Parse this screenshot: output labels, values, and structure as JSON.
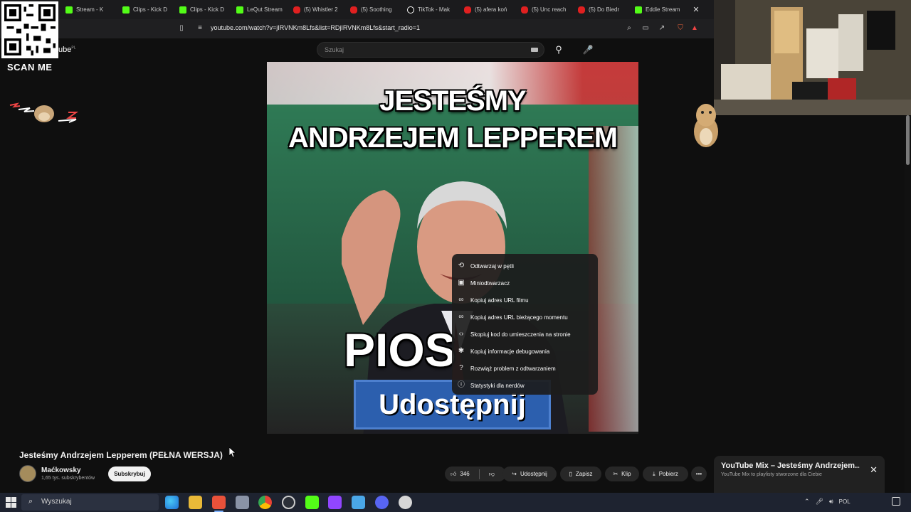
{
  "browser": {
    "tabs": [
      {
        "label": "Stream - K",
        "type": "kick"
      },
      {
        "label": "Clips - Kick D",
        "type": "kick"
      },
      {
        "label": "Clips - Kick D",
        "type": "kick"
      },
      {
        "label": "LeQut Stream",
        "type": "kick"
      },
      {
        "label": "(5) Whistler 2",
        "type": "yt"
      },
      {
        "label": "(5) Soothing",
        "type": "yt"
      },
      {
        "label": "TikTok - Mak",
        "type": "tt"
      },
      {
        "label": "(5) afera koń",
        "type": "yt"
      },
      {
        "label": "(5) Unc reach",
        "type": "yt"
      },
      {
        "label": "(5) Do Biedr",
        "type": "yt"
      },
      {
        "label": "Eddie Stream",
        "type": "kick"
      }
    ],
    "close_tab_glyph": "✕",
    "url": "youtube.com/watch?v=jIRVNKm8Lfs&list=RDjIRVNKm8Lfs&start_radio=1"
  },
  "overlay": {
    "scan_me": "SCAN ME"
  },
  "youtube": {
    "logo_text": "ube",
    "logo_region": "PL",
    "search_placeholder": "Szukaj"
  },
  "video": {
    "caption_line1": "JESTEŚMY",
    "caption_line2": "ANDRZEJEM LEPPEREM",
    "caption_line3": "PIOS",
    "share_overlay": "Udostępnij"
  },
  "context_menu": {
    "items": [
      {
        "label": "Odtwarzaj w pętli",
        "icon": "loop-icon"
      },
      {
        "label": "Miniodtwarzacz",
        "icon": "miniplayer-icon"
      },
      {
        "label": "Kopiuj adres URL filmu",
        "icon": "link-icon"
      },
      {
        "label": "Kopiuj adres URL bieżącego momentu",
        "icon": "link-icon"
      },
      {
        "label": "Skopiuj kod do umieszczenia na stronie",
        "icon": "code-icon"
      },
      {
        "label": "Kopiuj informacje debugowania",
        "icon": "bug-icon"
      },
      {
        "label": "Rozwiąż problem z odtwarzaniem",
        "icon": "help-icon"
      },
      {
        "label": "Statystyki dla nerdów",
        "icon": "info-icon"
      }
    ]
  },
  "watch": {
    "title": "Jesteśmy Andrzejem Lepperem (PEŁNA WERSJA)",
    "channel_name": "Maćkowsky",
    "subscriber_count": "1,65 tys. subskrybentów",
    "subscribe_label": "Subskrybuj",
    "like_count": "346",
    "share_label": "Udostępnij",
    "save_label": "Zapisz",
    "clip_label": "Klip",
    "download_label": "Pobierz"
  },
  "mix": {
    "title": "YouTube Mix – Jesteśmy Andrzejem...",
    "subtitle": "YouTube Mix to playlisty stworzone dla Ciebie"
  },
  "taskbar": {
    "search_label": "Wyszukaj",
    "language": "POL"
  },
  "colors": {
    "yt_bg": "#0f0f0f",
    "kick_green": "#53fc18",
    "yt_red": "#e02020",
    "taskbar": "#1e2330"
  }
}
